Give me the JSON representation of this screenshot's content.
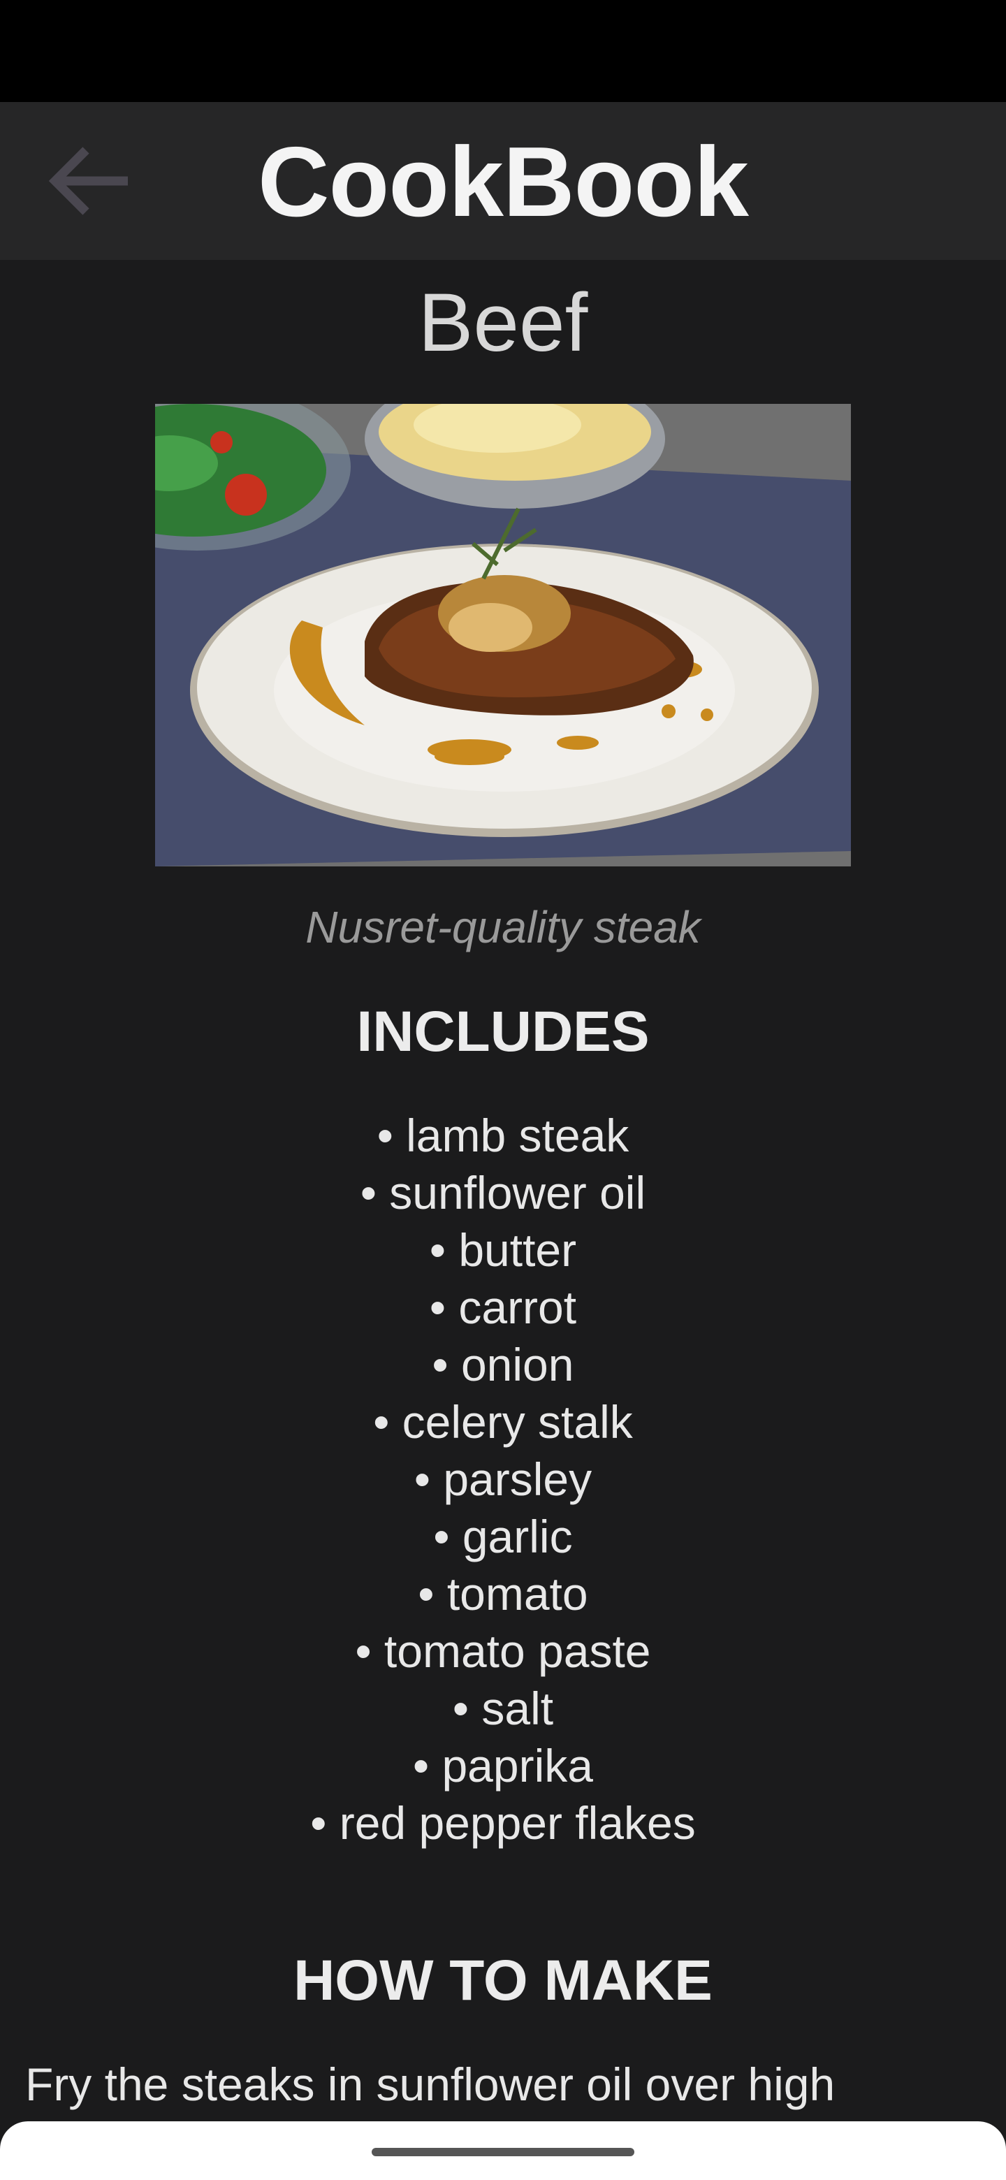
{
  "app_bar": {
    "title": "CookBook",
    "back_icon": "arrow-left-icon"
  },
  "recipe": {
    "category": "Beef",
    "image_description_icon": "steak-plate-image",
    "caption": "Nusret-quality steak",
    "includes_heading": "INCLUDES",
    "ingredients": [
      "• lamb steak",
      "• sunflower oil",
      "• butter",
      "• carrot",
      "• onion",
      "• celery stalk",
      "• parsley",
      "• garlic",
      "• tomato",
      "•  tomato paste",
      "• salt",
      "• paprika",
      "• red pepper flakes"
    ],
    "method_heading": "HOW TO MAKE",
    "method_text": "Fry the steaks in sunflower oil over high"
  },
  "colors": {
    "background": "#1b1b1c",
    "app_bar": "#262627",
    "status_bar": "#000000",
    "caption": "#9a9a9a",
    "nav_bar": "#ffffff"
  }
}
